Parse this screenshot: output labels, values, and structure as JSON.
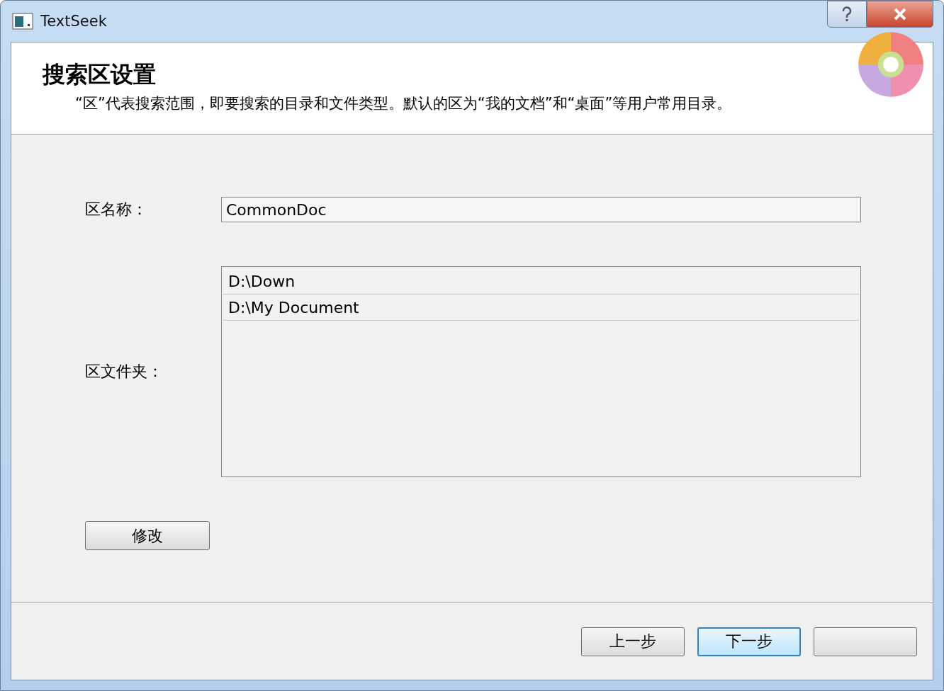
{
  "window": {
    "title": "TextSeek"
  },
  "header": {
    "title": "搜索区设置",
    "description": "“区”代表搜索范围，即要搜索的目录和文件类型。默认的区为“我的文档”和“桌面”等用户常用目录。"
  },
  "form": {
    "name_label": "区名称：",
    "name_value": "CommonDoc",
    "folders_label": "区文件夹：",
    "folders": [
      {
        "path": "D:\\Down",
        "selected": false
      },
      {
        "path": "D:\\My Document",
        "selected": false
      }
    ],
    "modify_button": "修改"
  },
  "footer": {
    "buttons": [
      {
        "label": "上一步",
        "default": false
      },
      {
        "label": "下一步",
        "default": true
      },
      {
        "default": false
      }
    ]
  }
}
